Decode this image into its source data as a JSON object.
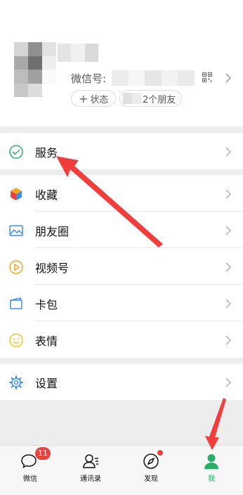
{
  "profile": {
    "wechat_id_label": "微信号:",
    "status_plus": "+",
    "status_label": "状态",
    "friends_label": "2个朋友"
  },
  "menu": {
    "services": "服务",
    "favorites": "收藏",
    "moments": "朋友圈",
    "channels": "视频号",
    "cards": "卡包",
    "stickers": "表情",
    "settings": "设置"
  },
  "tabbar": {
    "chats": "微信",
    "chats_badge": "11",
    "contacts": "通讯录",
    "discover": "发现",
    "me": "我"
  },
  "colors": {
    "accent_green": "#2aae67",
    "badge_red": "#e64340",
    "annotation_arrow": "#f23d3d"
  },
  "icons": {
    "services": "services-icon",
    "favorites": "favorites-cube-icon",
    "moments": "image-icon",
    "channels": "play-circle-icon",
    "cards": "wallet-icon",
    "stickers": "smile-icon",
    "settings": "gear-icon"
  }
}
